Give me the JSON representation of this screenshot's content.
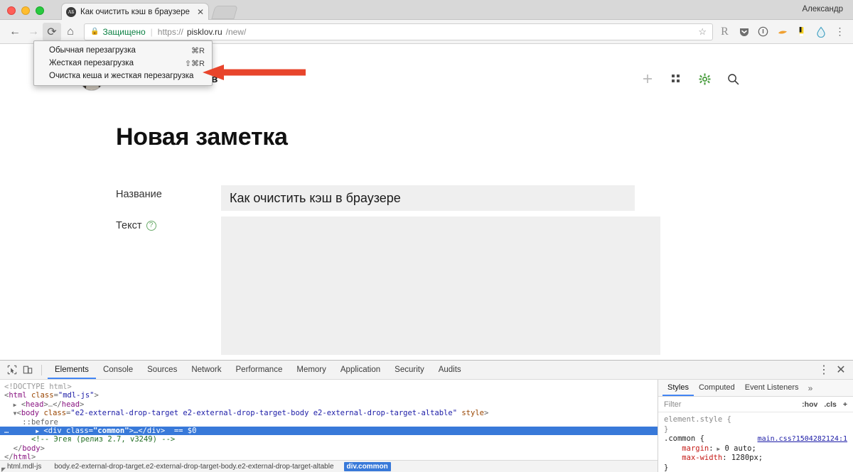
{
  "window": {
    "user_label": "Александр",
    "tab": {
      "title": "Как очистить кэш в браузере",
      "favicon_glyph": "АБ",
      "close_glyph": "✕"
    },
    "traffic_lights": [
      "close",
      "minimize",
      "maximize"
    ]
  },
  "toolbar": {
    "back_glyph": "←",
    "forward_glyph": "→",
    "reload_glyph": "⟳",
    "home_glyph": "⌂",
    "security_label": "Защищено",
    "url_scheme": "https://",
    "url_host": "pisklov.ru",
    "url_path": "/new/",
    "star_glyph": "☆",
    "extensions": [
      {
        "name": "readability-extension-icon",
        "glyph": "R"
      },
      {
        "name": "pocket-extension-icon",
        "glyph": "▼"
      },
      {
        "name": "info-extension-icon",
        "glyph": "ⓘ"
      },
      {
        "name": "orange-extension-icon",
        "glyph": "◣"
      },
      {
        "name": "bulb-extension-icon",
        "glyph": "▮"
      },
      {
        "name": "drop-extension-icon",
        "glyph": "◯"
      },
      {
        "name": "chrome-menu-icon",
        "glyph": "⋮"
      }
    ]
  },
  "context_menu": {
    "items": [
      {
        "label": "Обычная перезагрузка",
        "shortcut": "⌘R"
      },
      {
        "label": "Жесткая перезагрузка",
        "shortcut": "⇧⌘R"
      },
      {
        "label": "Очистка кеша и жесткая перезагрузка",
        "shortcut": ""
      }
    ],
    "highlight_color": "#e8452c"
  },
  "page": {
    "user_name": "Александр Писклов",
    "header_icons": [
      {
        "name": "add-icon",
        "glyph": "+"
      },
      {
        "name": "grid-icon",
        "glyph": "⠶"
      },
      {
        "name": "settings-gear-icon",
        "glyph": "✹"
      },
      {
        "name": "search-icon",
        "glyph": "🔍"
      }
    ],
    "accent_color": "#4a9d3f",
    "title": "Новая заметка",
    "form": {
      "title_label": "Название",
      "title_value": "Как очистить кэш в браузере",
      "title_placeholder": "",
      "text_label": "Текст",
      "text_help_glyph": "?",
      "text_value": "",
      "text_placeholder": ""
    }
  },
  "devtools": {
    "inspect_icon": "inspect-element-icon",
    "device_icon": "toggle-device-toolbar-icon",
    "tabs": [
      "Elements",
      "Console",
      "Sources",
      "Network",
      "Performance",
      "Memory",
      "Application",
      "Security",
      "Audits"
    ],
    "selected_tab": "Elements",
    "more_glyph": "⋮",
    "close_glyph": "✕",
    "dom": [
      {
        "indent": 0,
        "parts": [
          {
            "t": "doctype",
            "v": "<!DOCTYPE html>"
          }
        ]
      },
      {
        "indent": 0,
        "parts": [
          {
            "t": "punct",
            "v": "<"
          },
          {
            "t": "tag",
            "v": "html"
          },
          {
            "t": "sp",
            "v": " "
          },
          {
            "t": "attr",
            "v": "class"
          },
          {
            "t": "punct",
            "v": "="
          },
          {
            "t": "val",
            "v": "\"mdl-js\""
          },
          {
            "t": "punct",
            "v": ">"
          }
        ]
      },
      {
        "indent": 1,
        "triangle": true,
        "parts": [
          {
            "t": "punct",
            "v": "<"
          },
          {
            "t": "tag",
            "v": "head"
          },
          {
            "t": "punct",
            "v": ">"
          },
          {
            "t": "gray",
            "v": "…"
          },
          {
            "t": "punct",
            "v": "</"
          },
          {
            "t": "tag",
            "v": "head"
          },
          {
            "t": "punct",
            "v": ">"
          }
        ]
      },
      {
        "indent": 1,
        "triangle_open": true,
        "parts": [
          {
            "t": "punct",
            "v": "<"
          },
          {
            "t": "tag",
            "v": "body"
          },
          {
            "t": "sp",
            "v": " "
          },
          {
            "t": "attr",
            "v": "class"
          },
          {
            "t": "punct",
            "v": "="
          },
          {
            "t": "val",
            "v": "\"e2-external-drop-target e2-external-drop-target-body e2-external-drop-target-altable\""
          },
          {
            "t": "sp",
            "v": " "
          },
          {
            "t": "attr",
            "v": "style"
          },
          {
            "t": "punct",
            "v": ">"
          }
        ]
      },
      {
        "indent": 2,
        "parts": [
          {
            "t": "pseudo",
            "v": "::before"
          }
        ]
      },
      {
        "indent": 2,
        "selected": true,
        "ellipsis": true,
        "triangle": true,
        "parts": [
          {
            "t": "punct",
            "v": "<"
          },
          {
            "t": "tag",
            "v": "div"
          },
          {
            "t": "sp",
            "v": " "
          },
          {
            "t": "attr",
            "v": "class"
          },
          {
            "t": "punct",
            "v": "="
          },
          {
            "t": "valb",
            "v": "\"common\""
          },
          {
            "t": "punct",
            "v": ">"
          },
          {
            "t": "gray",
            "v": "…"
          },
          {
            "t": "punct",
            "v": "</"
          },
          {
            "t": "tag",
            "v": "div"
          },
          {
            "t": "punct",
            "v": ">"
          },
          {
            "t": "sp",
            "v": "  "
          },
          {
            "t": "dollar",
            "v": "== $0"
          }
        ]
      },
      {
        "indent": 3,
        "parts": [
          {
            "t": "comment",
            "v": "<!-- Эгея (релиз 2.7, v3249) -->"
          }
        ]
      },
      {
        "indent": 1,
        "parts": [
          {
            "t": "punct",
            "v": "</"
          },
          {
            "t": "tag",
            "v": "body"
          },
          {
            "t": "punct",
            "v": ">"
          }
        ]
      },
      {
        "indent": 0,
        "parts": [
          {
            "t": "punct",
            "v": "</"
          },
          {
            "t": "tag",
            "v": "html"
          },
          {
            "t": "punct",
            "v": ">"
          }
        ]
      }
    ],
    "styles": {
      "tabs": [
        "Styles",
        "Computed",
        "Event Listeners"
      ],
      "selected_tab": "Styles",
      "overflow_glyph": "»",
      "filter_placeholder": "Filter",
      "hov_label": ":hov",
      "cls_label": ".cls",
      "plus_label": "+",
      "rules": [
        {
          "selector": "element.style {",
          "source": "",
          "declarations": [],
          "close": "}"
        },
        {
          "selector": ".common {",
          "source": "main.css?1504282124:1",
          "declarations": [
            {
              "prop": "margin",
              "value": "0 auto;",
              "has_triangle": true
            },
            {
              "prop": "max-width",
              "value": "1280px;",
              "has_triangle": false
            }
          ],
          "close": "}"
        }
      ]
    },
    "breadcrumb": [
      {
        "label": "html.mdl-js",
        "selected": false
      },
      {
        "label": "body.e2-external-drop-target.e2-external-drop-target-body.e2-external-drop-target-altable",
        "selected": false
      },
      {
        "label": "div.common",
        "selected": true
      }
    ]
  }
}
